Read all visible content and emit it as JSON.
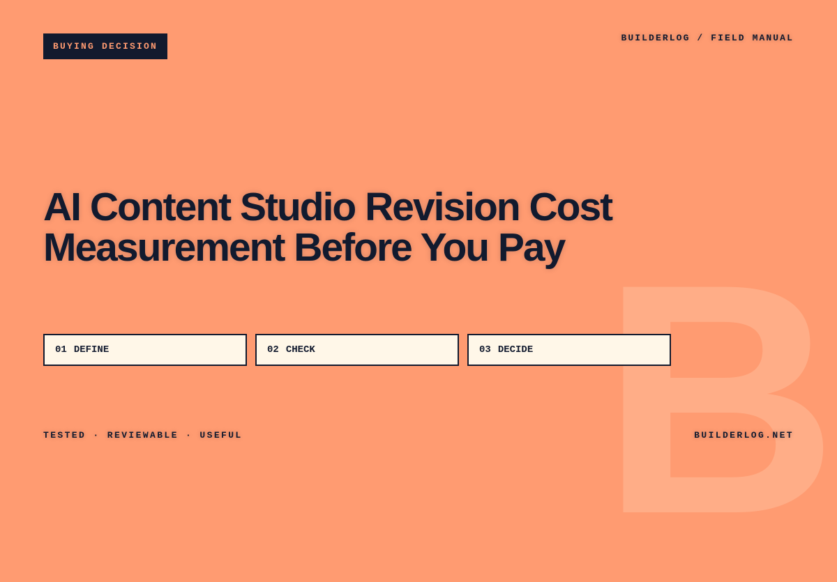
{
  "brand": {
    "badge": "BUYING DECISION",
    "top_right": "BUILDERLOG / FIELD MANUAL",
    "watermark_letter": "B"
  },
  "title": {
    "line1": "AI Content Studio Revision Cost",
    "line2": "Measurement Before You Pay"
  },
  "steps": [
    {
      "number": "01",
      "label": "DEFINE"
    },
    {
      "number": "02",
      "label": "CHECK"
    },
    {
      "number": "03",
      "label": "DECIDE"
    }
  ],
  "footer": {
    "tagline": "TESTED · REVIEWABLE · USEFUL",
    "site": "BUILDERLOG.NET"
  },
  "colors": {
    "background": "#ff9b71",
    "ink": "#121a2e",
    "card": "#fff7e8",
    "watermark": "#ffb08a"
  }
}
